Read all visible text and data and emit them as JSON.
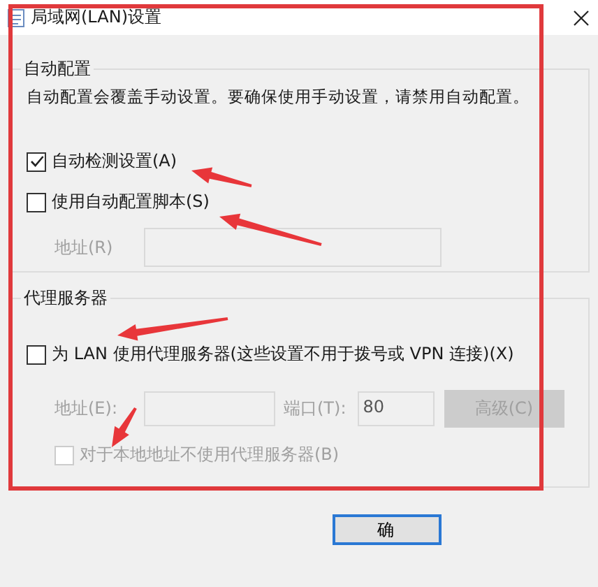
{
  "window": {
    "title": "局域网(LAN)设置"
  },
  "auto_config": {
    "title": "自动配置",
    "description": "自动配置会覆盖手动设置。要确保使用手动设置，请禁用自动配置。",
    "options": [
      {
        "label": "自动检测设置(A)",
        "checked": true
      },
      {
        "label": "使用自动配置脚本(S)",
        "checked": false
      }
    ],
    "address": {
      "label": "地址(R)",
      "disabled": true
    }
  },
  "proxy": {
    "title": "代理服务器",
    "use_proxy": {
      "label": "为 LAN 使用代理服务器(这些设置不用于拨号或 VPN 连接)(X)",
      "checked": false,
      "disabled": false
    },
    "address": {
      "label": "地址(E):",
      "disabled": true
    },
    "port": {
      "label": "端口(T):",
      "value": "80",
      "disabled": true
    },
    "advanced_button": {
      "label": "高级(C)",
      "disabled": true
    },
    "bypass_local": {
      "label": "对于本地地址不使用代理服务器(B)",
      "checked": false,
      "disabled": true
    }
  },
  "buttons": [
    {
      "label": "确",
      "default": true
    }
  ]
}
